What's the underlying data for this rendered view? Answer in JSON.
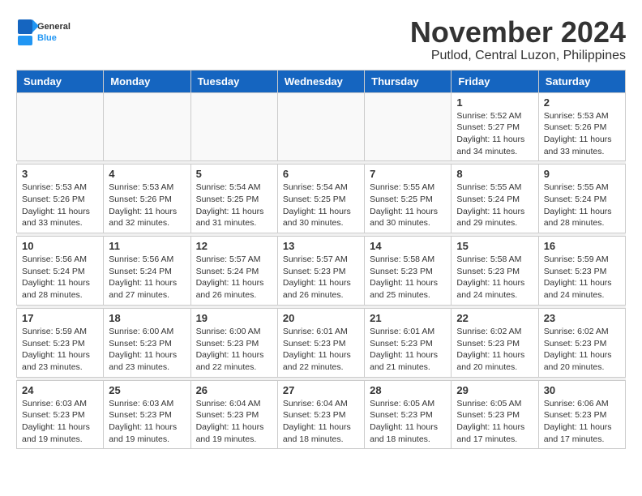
{
  "logo": {
    "general": "General",
    "blue": "Blue"
  },
  "title": "November 2024",
  "subtitle": "Putlod, Central Luzon, Philippines",
  "days_of_week": [
    "Sunday",
    "Monday",
    "Tuesday",
    "Wednesday",
    "Thursday",
    "Friday",
    "Saturday"
  ],
  "weeks": [
    [
      {
        "day": "",
        "info": ""
      },
      {
        "day": "",
        "info": ""
      },
      {
        "day": "",
        "info": ""
      },
      {
        "day": "",
        "info": ""
      },
      {
        "day": "",
        "info": ""
      },
      {
        "day": "1",
        "info": "Sunrise: 5:52 AM\nSunset: 5:27 PM\nDaylight: 11 hours and 34 minutes."
      },
      {
        "day": "2",
        "info": "Sunrise: 5:53 AM\nSunset: 5:26 PM\nDaylight: 11 hours and 33 minutes."
      }
    ],
    [
      {
        "day": "3",
        "info": "Sunrise: 5:53 AM\nSunset: 5:26 PM\nDaylight: 11 hours and 33 minutes."
      },
      {
        "day": "4",
        "info": "Sunrise: 5:53 AM\nSunset: 5:26 PM\nDaylight: 11 hours and 32 minutes."
      },
      {
        "day": "5",
        "info": "Sunrise: 5:54 AM\nSunset: 5:25 PM\nDaylight: 11 hours and 31 minutes."
      },
      {
        "day": "6",
        "info": "Sunrise: 5:54 AM\nSunset: 5:25 PM\nDaylight: 11 hours and 30 minutes."
      },
      {
        "day": "7",
        "info": "Sunrise: 5:55 AM\nSunset: 5:25 PM\nDaylight: 11 hours and 30 minutes."
      },
      {
        "day": "8",
        "info": "Sunrise: 5:55 AM\nSunset: 5:24 PM\nDaylight: 11 hours and 29 minutes."
      },
      {
        "day": "9",
        "info": "Sunrise: 5:55 AM\nSunset: 5:24 PM\nDaylight: 11 hours and 28 minutes."
      }
    ],
    [
      {
        "day": "10",
        "info": "Sunrise: 5:56 AM\nSunset: 5:24 PM\nDaylight: 11 hours and 28 minutes."
      },
      {
        "day": "11",
        "info": "Sunrise: 5:56 AM\nSunset: 5:24 PM\nDaylight: 11 hours and 27 minutes."
      },
      {
        "day": "12",
        "info": "Sunrise: 5:57 AM\nSunset: 5:24 PM\nDaylight: 11 hours and 26 minutes."
      },
      {
        "day": "13",
        "info": "Sunrise: 5:57 AM\nSunset: 5:23 PM\nDaylight: 11 hours and 26 minutes."
      },
      {
        "day": "14",
        "info": "Sunrise: 5:58 AM\nSunset: 5:23 PM\nDaylight: 11 hours and 25 minutes."
      },
      {
        "day": "15",
        "info": "Sunrise: 5:58 AM\nSunset: 5:23 PM\nDaylight: 11 hours and 24 minutes."
      },
      {
        "day": "16",
        "info": "Sunrise: 5:59 AM\nSunset: 5:23 PM\nDaylight: 11 hours and 24 minutes."
      }
    ],
    [
      {
        "day": "17",
        "info": "Sunrise: 5:59 AM\nSunset: 5:23 PM\nDaylight: 11 hours and 23 minutes."
      },
      {
        "day": "18",
        "info": "Sunrise: 6:00 AM\nSunset: 5:23 PM\nDaylight: 11 hours and 23 minutes."
      },
      {
        "day": "19",
        "info": "Sunrise: 6:00 AM\nSunset: 5:23 PM\nDaylight: 11 hours and 22 minutes."
      },
      {
        "day": "20",
        "info": "Sunrise: 6:01 AM\nSunset: 5:23 PM\nDaylight: 11 hours and 22 minutes."
      },
      {
        "day": "21",
        "info": "Sunrise: 6:01 AM\nSunset: 5:23 PM\nDaylight: 11 hours and 21 minutes."
      },
      {
        "day": "22",
        "info": "Sunrise: 6:02 AM\nSunset: 5:23 PM\nDaylight: 11 hours and 20 minutes."
      },
      {
        "day": "23",
        "info": "Sunrise: 6:02 AM\nSunset: 5:23 PM\nDaylight: 11 hours and 20 minutes."
      }
    ],
    [
      {
        "day": "24",
        "info": "Sunrise: 6:03 AM\nSunset: 5:23 PM\nDaylight: 11 hours and 19 minutes."
      },
      {
        "day": "25",
        "info": "Sunrise: 6:03 AM\nSunset: 5:23 PM\nDaylight: 11 hours and 19 minutes."
      },
      {
        "day": "26",
        "info": "Sunrise: 6:04 AM\nSunset: 5:23 PM\nDaylight: 11 hours and 19 minutes."
      },
      {
        "day": "27",
        "info": "Sunrise: 6:04 AM\nSunset: 5:23 PM\nDaylight: 11 hours and 18 minutes."
      },
      {
        "day": "28",
        "info": "Sunrise: 6:05 AM\nSunset: 5:23 PM\nDaylight: 11 hours and 18 minutes."
      },
      {
        "day": "29",
        "info": "Sunrise: 6:05 AM\nSunset: 5:23 PM\nDaylight: 11 hours and 17 minutes."
      },
      {
        "day": "30",
        "info": "Sunrise: 6:06 AM\nSunset: 5:23 PM\nDaylight: 11 hours and 17 minutes."
      }
    ]
  ]
}
